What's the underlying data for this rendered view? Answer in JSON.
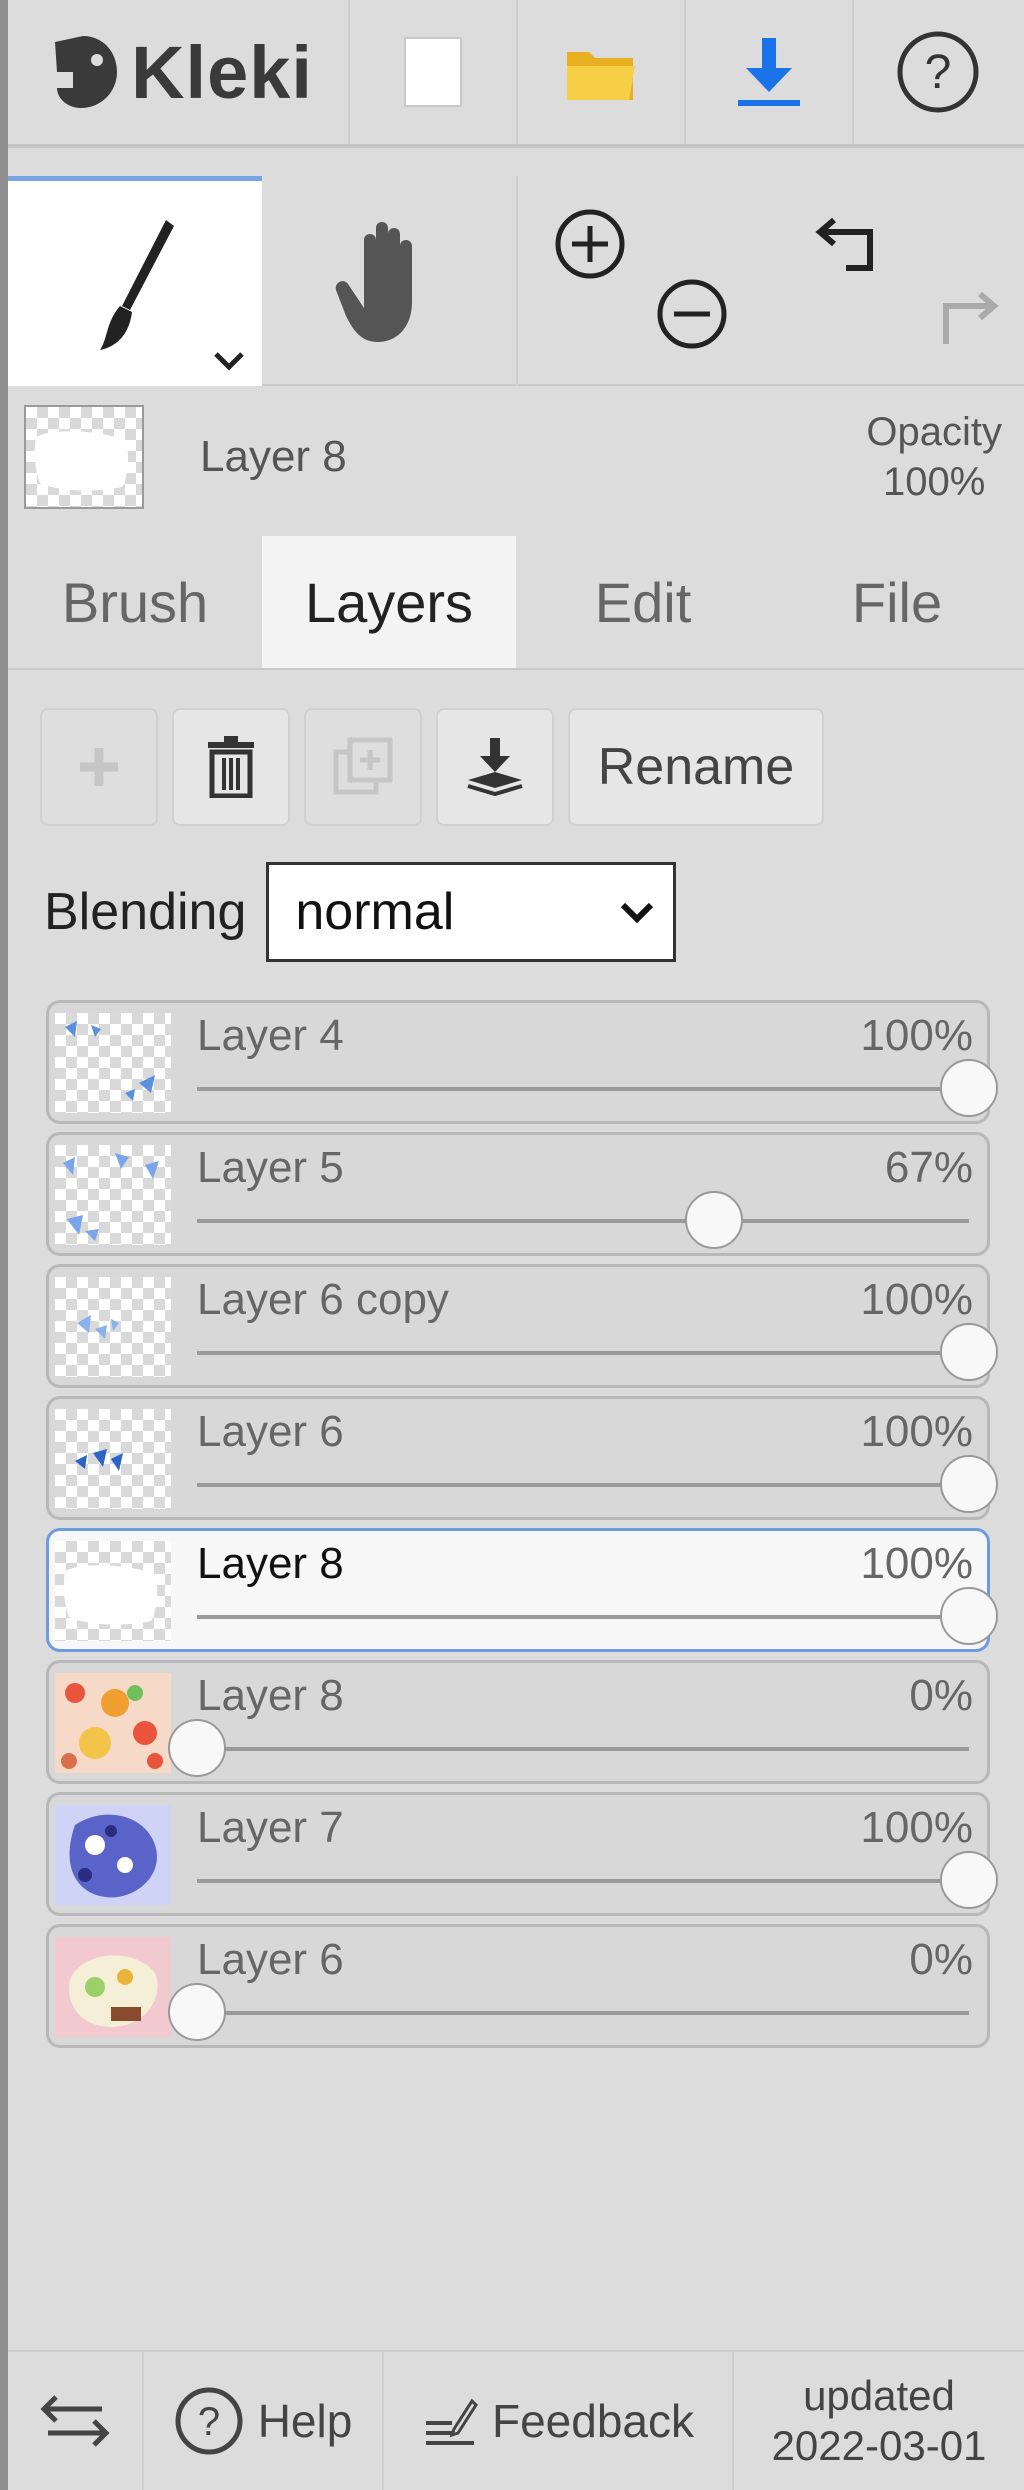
{
  "app": {
    "name": "Kleki",
    "icons": {
      "logo": "kleki-logo-icon",
      "new": "new-image-icon",
      "open": "folder-icon",
      "save": "download-icon",
      "help": "help-icon"
    }
  },
  "tools": {
    "active": "brush",
    "items": [
      {
        "id": "brush",
        "icon": "brush-icon"
      },
      {
        "id": "hand",
        "icon": "hand-icon"
      },
      {
        "id": "zoom",
        "icon": "zoom-in-icon / zoom-out-icon"
      },
      {
        "id": "history",
        "icon": "undo-icon / redo-icon"
      }
    ]
  },
  "current_layer": {
    "name": "Layer 8",
    "opacity_label": "Opacity",
    "opacity_value": "100%"
  },
  "tabs": [
    {
      "label": "Brush",
      "active": false
    },
    {
      "label": "Layers",
      "active": true
    },
    {
      "label": "Edit",
      "active": false
    },
    {
      "label": "File",
      "active": false
    }
  ],
  "layer_actions": {
    "add_icon": "plus-icon",
    "delete_icon": "trash-icon",
    "duplicate_icon": "duplicate-icon",
    "merge_icon": "merge-down-icon",
    "rename_label": "Rename"
  },
  "blending": {
    "label": "Blending",
    "value": "normal"
  },
  "layers": [
    {
      "name": "Layer 4",
      "opacity": "100%",
      "level": 1.0,
      "selected": false
    },
    {
      "name": "Layer 5",
      "opacity": "67%",
      "level": 0.67,
      "selected": false
    },
    {
      "name": "Layer 6 copy",
      "opacity": "100%",
      "level": 1.0,
      "selected": false
    },
    {
      "name": "Layer 6",
      "opacity": "100%",
      "level": 1.0,
      "selected": false
    },
    {
      "name": "Layer 8",
      "opacity": "100%",
      "level": 1.0,
      "selected": true
    },
    {
      "name": "Layer 8",
      "opacity": "0%",
      "level": 0.0,
      "selected": false
    },
    {
      "name": "Layer 7",
      "opacity": "100%",
      "level": 1.0,
      "selected": false
    },
    {
      "name": "Layer 6",
      "opacity": "0%",
      "level": 0.0,
      "selected": false
    }
  ],
  "footer": {
    "help_label": "Help",
    "feedback_label": "Feedback",
    "updated_line1": "updated",
    "updated_line2": "2022-03-01"
  },
  "colors": {
    "accent": "#7ba4e6",
    "save_icon": "#1a73e8",
    "folder_icon": "#f2c230"
  }
}
